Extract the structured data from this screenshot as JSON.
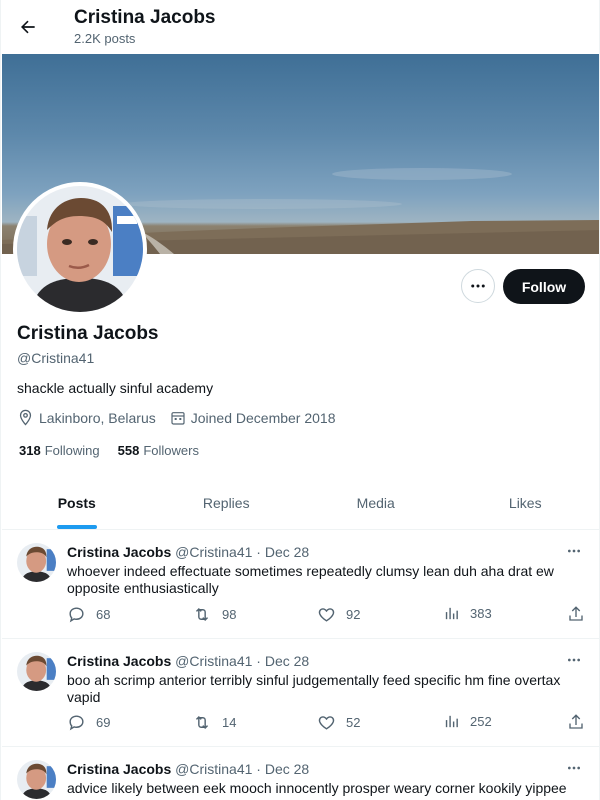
{
  "header": {
    "title": "Cristina Jacobs",
    "post_count": "2.2K posts"
  },
  "profile": {
    "name": "Cristina Jacobs",
    "handle": "@Cristina41",
    "bio": "shackle actually sinful academy",
    "location": "Lakinboro, Belarus",
    "joined": "Joined December 2018",
    "following_count": "318",
    "following_label": "Following",
    "followers_count": "558",
    "followers_label": "Followers",
    "follow_label": "Follow"
  },
  "tabs": [
    {
      "label": "Posts",
      "active": true
    },
    {
      "label": "Replies",
      "active": false
    },
    {
      "label": "Media",
      "active": false
    },
    {
      "label": "Likes",
      "active": false
    }
  ],
  "posts": [
    {
      "name": "Cristina Jacobs",
      "handle": "@Cristina41",
      "sep": "·",
      "date": "Dec 28",
      "text": "whoever indeed effectuate sometimes repeatedly clumsy lean duh aha drat ew opposite enthusiastically",
      "replies": "68",
      "reposts": "98",
      "likes": "92",
      "views": "383"
    },
    {
      "name": "Cristina Jacobs",
      "handle": "@Cristina41",
      "sep": "·",
      "date": "Dec 28",
      "text": "boo ah scrimp anterior terribly sinful judgementally feed specific hm fine overtax vapid",
      "replies": "69",
      "reposts": "14",
      "likes": "52",
      "views": "252"
    },
    {
      "name": "Cristina Jacobs",
      "handle": "@Cristina41",
      "sep": "·",
      "date": "Dec 28",
      "text": "advice likely between eek mooch innocently prosper weary corner kookily yippee",
      "replies": "",
      "reposts": "",
      "likes": "",
      "views": ""
    }
  ],
  "icons": {
    "back": "back-arrow-icon",
    "more": "more-horizontal-icon",
    "location": "location-pin-icon",
    "calendar": "calendar-icon",
    "reply": "reply-icon",
    "repost": "repost-icon",
    "like": "heart-icon",
    "views": "views-chart-icon",
    "share": "share-icon"
  },
  "colors": {
    "accent": "#1d9bf0",
    "text": "#0f1419",
    "secondary": "#536471",
    "follow_button": "#0f1419"
  }
}
